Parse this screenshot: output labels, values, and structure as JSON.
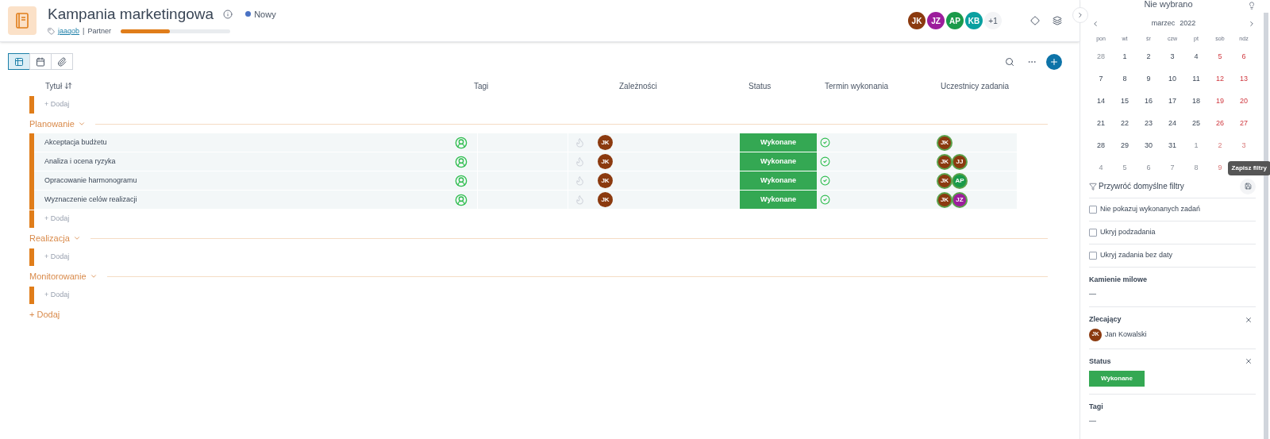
{
  "header": {
    "title": "Kampania marketingowa",
    "status": {
      "label": "Nowy",
      "color": "#4a72c4"
    },
    "tag": "jaaqob",
    "separator": "|",
    "client": "Partner",
    "progress": {
      "level": 0.45
    },
    "members": [
      {
        "initials": "JK",
        "color": "#8b3a0f"
      },
      {
        "initials": "JZ",
        "color": "#9c1d9c"
      },
      {
        "initials": "AP",
        "color": "#1a9a4a"
      },
      {
        "initials": "KB",
        "color": "#0aa0a0"
      }
    ],
    "more": "+1"
  },
  "views": [
    {
      "kind": "table",
      "selected": true
    },
    {
      "kind": "calendar",
      "selected": false
    },
    {
      "kind": "attachments",
      "selected": false
    }
  ],
  "table": {
    "columns": [
      "Tytuł",
      "Tagi",
      "Zależności",
      "Status",
      "Termin wykonania",
      "Uczestnicy zadania"
    ],
    "top_add": "+ Dodaj",
    "groups": [
      {
        "name": "Planowanie",
        "expanded": true,
        "add": "+ Dodaj",
        "tasks": [
          {
            "title": "Akceptacja budżetu",
            "owner": {
              "initials": "JK",
              "color": "#8b3a0f"
            },
            "status": {
              "label": "Wykonane",
              "color": "#34a853"
            },
            "done": true,
            "participants": [
              {
                "initials": "JK",
                "color": "#8b3a0f"
              }
            ]
          },
          {
            "title": "Analiza i ocena ryzyka",
            "owner": {
              "initials": "JK",
              "color": "#8b3a0f"
            },
            "status": {
              "label": "Wykonane",
              "color": "#34a853"
            },
            "done": true,
            "participants": [
              {
                "initials": "JK",
                "color": "#8b3a0f"
              },
              {
                "initials": "JJ",
                "color": "#8b3a0f"
              }
            ]
          },
          {
            "title": "Opracowanie harmonogramu",
            "owner": {
              "initials": "JK",
              "color": "#8b3a0f"
            },
            "status": {
              "label": "Wykonane",
              "color": "#34a853"
            },
            "done": true,
            "participants": [
              {
                "initials": "JK",
                "color": "#8b3a0f"
              },
              {
                "initials": "AP",
                "color": "#1a9a4a"
              }
            ]
          },
          {
            "title": "Wyznaczenie celów realizacji",
            "owner": {
              "initials": "JK",
              "color": "#8b3a0f"
            },
            "status": {
              "label": "Wykonane",
              "color": "#34a853"
            },
            "done": true,
            "participants": [
              {
                "initials": "JK",
                "color": "#8b3a0f"
              },
              {
                "initials": "JZ",
                "color": "#9c1d9c"
              }
            ]
          }
        ]
      },
      {
        "name": "Realizacja",
        "expanded": true,
        "add": "+ Dodaj"
      },
      {
        "name": "Monitorowanie",
        "expanded": true,
        "add": "+ Dodaj"
      }
    ],
    "add_group": "+ Dodaj"
  },
  "panel": {
    "selected_label": "Nie wybrano",
    "month": "marzec",
    "year": "2022",
    "weekdays": [
      "pon",
      "wt",
      "śr",
      "czw",
      "pt",
      "sob",
      "ndz"
    ],
    "days": [
      {
        "day": "28",
        "outside": true
      },
      {
        "day": "1",
        "outside": false
      },
      {
        "day": "2",
        "outside": false
      },
      {
        "day": "3",
        "outside": false
      },
      {
        "day": "4",
        "outside": false
      },
      {
        "day": "5",
        "outside": false
      },
      {
        "day": "6",
        "outside": false
      },
      {
        "day": "7",
        "outside": false
      },
      {
        "day": "8",
        "outside": false
      },
      {
        "day": "9",
        "outside": false
      },
      {
        "day": "10",
        "outside": false
      },
      {
        "day": "11",
        "outside": false
      },
      {
        "day": "12",
        "outside": false
      },
      {
        "day": "13",
        "outside": false
      },
      {
        "day": "14",
        "outside": false
      },
      {
        "day": "15",
        "outside": false
      },
      {
        "day": "16",
        "outside": false
      },
      {
        "day": "17",
        "outside": false
      },
      {
        "day": "18",
        "outside": false
      },
      {
        "day": "19",
        "outside": false
      },
      {
        "day": "20",
        "outside": false
      },
      {
        "day": "21",
        "outside": false
      },
      {
        "day": "22",
        "outside": false
      },
      {
        "day": "23",
        "outside": false
      },
      {
        "day": "24",
        "outside": false
      },
      {
        "day": "25",
        "outside": false
      },
      {
        "day": "26",
        "outside": false
      },
      {
        "day": "27",
        "outside": false
      },
      {
        "day": "28",
        "outside": false
      },
      {
        "day": "29",
        "outside": false
      },
      {
        "day": "30",
        "outside": false
      },
      {
        "day": "31",
        "outside": false
      },
      {
        "day": "1",
        "outside": true
      },
      {
        "day": "2",
        "outside": true
      },
      {
        "day": "3",
        "outside": true
      },
      {
        "day": "4",
        "outside": true
      },
      {
        "day": "5",
        "outside": true
      },
      {
        "day": "6",
        "outside": true
      },
      {
        "day": "7",
        "outside": true
      },
      {
        "day": "8",
        "outside": true
      },
      {
        "day": "9",
        "outside": true
      }
    ],
    "reset": "Przywróć domyślne filtry",
    "save_tooltip": "Zapisz filtry",
    "checkboxes": [
      {
        "label": "Nie pokazuj wykonanych zadań",
        "checked": false
      },
      {
        "label": "Ukryj podzadania",
        "checked": false
      },
      {
        "label": "Ukryj zadania bez daty",
        "checked": false
      }
    ],
    "milestones": {
      "title": "Kamienie milowe",
      "value": "—"
    },
    "assigner": {
      "title": "Zlecający",
      "person": {
        "initials": "JK",
        "color": "#8b3a0f",
        "name": "Jan Kowalski"
      }
    },
    "status": {
      "title": "Status",
      "value": {
        "label": "Wykonane",
        "color": "#34a853"
      }
    },
    "tags": {
      "title": "Tagi",
      "value": "—"
    }
  }
}
